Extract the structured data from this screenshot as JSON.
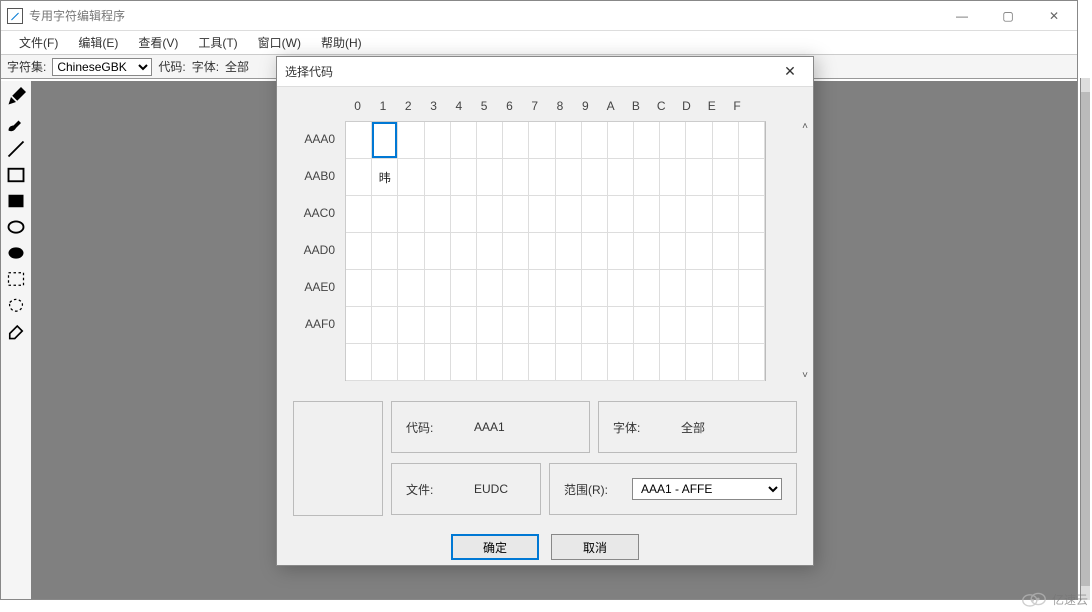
{
  "window": {
    "title": "专用字符编辑程序"
  },
  "menu": {
    "file": "文件(F)",
    "edit": "编辑(E)",
    "view": "查看(V)",
    "tools": "工具(T)",
    "window": "窗口(W)",
    "help": "帮助(H)"
  },
  "toolbar": {
    "charset_label": "字符集:",
    "charset_value": "ChineseGBK",
    "code_label": "代码:",
    "font_label": "字体:",
    "font_value": "全部"
  },
  "tools": [
    "pencil",
    "brush",
    "line",
    "rect",
    "filled-rect",
    "ellipse",
    "filled-ellipse",
    "dotted-select",
    "freeform-select",
    "eraser"
  ],
  "dialog": {
    "title": "选择代码",
    "columns": [
      "0",
      "1",
      "2",
      "3",
      "4",
      "5",
      "6",
      "7",
      "8",
      "9",
      "A",
      "B",
      "C",
      "D",
      "E",
      "F"
    ],
    "rows": [
      "AAA0",
      "AAB0",
      "AAC0",
      "AAD0",
      "AAE0",
      "AAF0"
    ],
    "selected_cell": {
      "row": 0,
      "col": 1
    },
    "glyph_cell": {
      "row": 1,
      "col": 1,
      "glyph": "𬀩"
    },
    "code_label": "代码:",
    "code_value": "AAA1",
    "font_label": "字体:",
    "font_value": "全部",
    "file_label": "文件:",
    "file_value": "EUDC",
    "range_label": "范围(R):",
    "range_value": "AAA1 - AFFE",
    "ok": "确定",
    "cancel": "取消"
  },
  "watermark": {
    "text": "亿速云"
  }
}
